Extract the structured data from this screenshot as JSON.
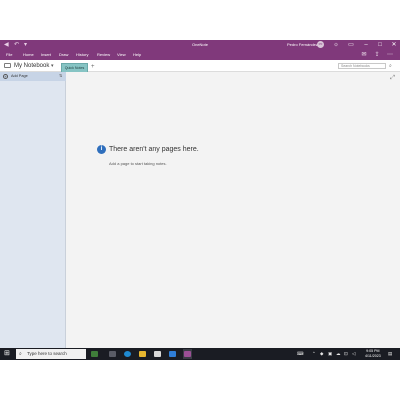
{
  "window": {
    "app_title": "OneNote",
    "user_name": "Pedro Fernández",
    "avatar_initials": "PF",
    "colors": {
      "brand": "#80397b",
      "section_tab": "#86c4c4",
      "pane": "#dfe6f0",
      "info": "#2f6fbd"
    }
  },
  "ribbon": {
    "tabs": [
      "File",
      "Home",
      "Insert",
      "Draw",
      "History",
      "Review",
      "View",
      "Help"
    ]
  },
  "notebook": {
    "name": "My Notebook",
    "section_tab": "Quick Notes",
    "add_section": "+",
    "search_placeholder": "Search Notebooks"
  },
  "pages": {
    "add_page_label": "Add Page"
  },
  "canvas": {
    "empty_title": "There aren't any pages here.",
    "empty_subtitle": "Add a page to start taking notes."
  },
  "taskbar": {
    "search_placeholder": "Type here to search",
    "time": "9:05 PM",
    "date": "4/11/2023"
  }
}
